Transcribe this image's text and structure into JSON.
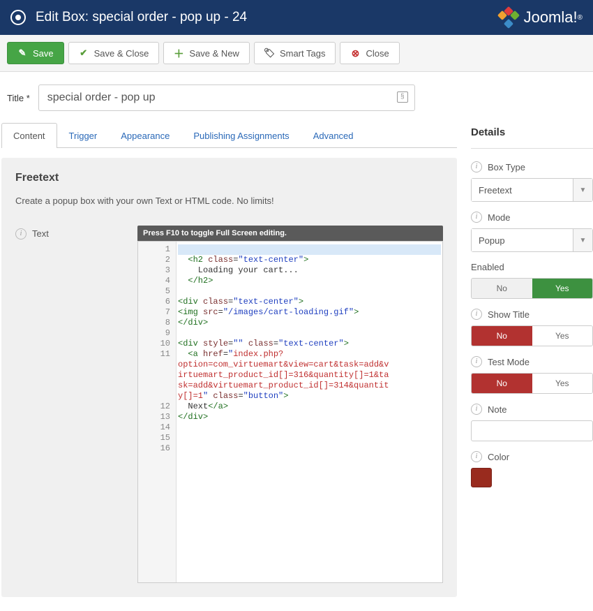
{
  "header": {
    "title": "Edit Box: special order - pop up - 24",
    "logo": "Joomla!"
  },
  "toolbar": {
    "save": "Save",
    "saveClose": "Save & Close",
    "saveNew": "Save & New",
    "smartTags": "Smart Tags",
    "close": "Close"
  },
  "titleField": {
    "label": "Title *",
    "value": "special order - pop up"
  },
  "tabs": [
    "Content",
    "Trigger",
    "Appearance",
    "Publishing Assignments",
    "Advanced"
  ],
  "panel": {
    "heading": "Freetext",
    "desc": "Create a popup box with your own Text or HTML code. No limits!",
    "textLabel": "Text",
    "editorTip": "Press F10 to toggle Full Screen editing."
  },
  "details": {
    "heading": "Details",
    "boxType": {
      "label": "Box Type",
      "value": "Freetext"
    },
    "mode": {
      "label": "Mode",
      "value": "Popup"
    },
    "enabled": {
      "label": "Enabled",
      "no": "No",
      "yes": "Yes"
    },
    "showTitle": {
      "label": "Show Title",
      "no": "No",
      "yes": "Yes"
    },
    "testMode": {
      "label": "Test Mode",
      "no": "No",
      "yes": "Yes"
    },
    "note": {
      "label": "Note"
    },
    "color": {
      "label": "Color",
      "value": "#992b1e"
    }
  },
  "code": {
    "lines": 16
  }
}
